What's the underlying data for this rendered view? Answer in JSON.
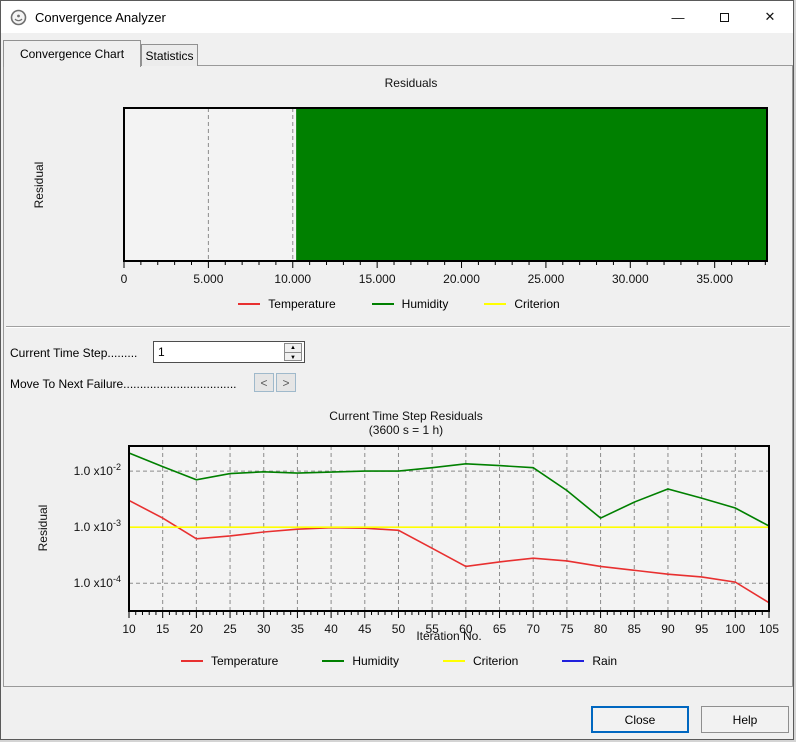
{
  "window": {
    "title": "Convergence Analyzer"
  },
  "icons": {
    "minimize_glyph": "—",
    "close_glyph": "✕",
    "spin_up": "▲",
    "spin_down": "▼"
  },
  "tabs": [
    {
      "label": "Convergence Chart",
      "active": true
    },
    {
      "label": "Statistics",
      "active": false
    }
  ],
  "controls": {
    "time_step_label": "Current Time Step.........",
    "time_step_value": "1",
    "next_failure_label": "Move To Next Failure..................................",
    "prev_glyph": "<",
    "next_glyph": ">"
  },
  "buttons": {
    "close": "Close",
    "help": "Help"
  },
  "colors": {
    "temperature": "#e83030",
    "humidity": "#008000",
    "criterion": "#ffff00",
    "rain": "#2020dd",
    "plot_bg": "#f3f3f3",
    "grid": "#8c8c8c",
    "accent_focus": "#0067c0"
  },
  "chart_data": [
    {
      "type": "area",
      "title": "Residuals",
      "ylabel": "Residual",
      "xlabel": "",
      "xlim": [
        0,
        38100
      ],
      "x_tick_major_step": 5000,
      "x_tick_minor_step": 1000,
      "x_tick_labels": [
        "0",
        "5.000",
        "10.000",
        "15.000",
        "20.000",
        "25.000",
        "30.000",
        "35.000"
      ],
      "gridlines_x": [
        5000,
        10000
      ],
      "filled_region": {
        "series": "Humidity",
        "from": 10200,
        "to": 38100,
        "color": "#008000"
      },
      "grid": true,
      "legend_position": "bottom",
      "legend": [
        {
          "label": "Temperature",
          "color": "#e83030"
        },
        {
          "label": "Humidity",
          "color": "#008000"
        },
        {
          "label": "Criterion",
          "color": "#ffff00"
        }
      ]
    },
    {
      "type": "line",
      "title": "Current Time Step Residuals",
      "subtitle": "(3600 s = 1 h)",
      "xlabel": "Iteration No.",
      "ylabel": "Residual",
      "yscale": "log",
      "ylim": [
        3.2e-05,
        0.028
      ],
      "x": [
        10,
        15,
        20,
        25,
        30,
        35,
        40,
        45,
        50,
        55,
        60,
        65,
        70,
        75,
        80,
        85,
        90,
        95,
        100,
        105
      ],
      "x_tick_minor_step": 1,
      "y_ticks": [
        {
          "value": 0.01,
          "mantissa": "1.0 x10",
          "exponent": "-2"
        },
        {
          "value": 0.001,
          "mantissa": "1.0 x10",
          "exponent": "-3"
        },
        {
          "value": 0.0001,
          "mantissa": "1.0 x10",
          "exponent": "-4"
        }
      ],
      "series": [
        {
          "name": "Temperature",
          "color": "#e83030",
          "values": [
            0.003,
            0.00145,
            0.00062,
            0.0007,
            0.00082,
            0.00092,
            0.00098,
            0.00096,
            0.00088,
            0.00042,
            0.0002,
            0.00024,
            0.00028,
            0.00025,
            0.0002,
            0.00017,
            0.000145,
            0.00013,
            0.000105,
            4.5e-05
          ]
        },
        {
          "name": "Humidity",
          "color": "#008000",
          "values": [
            0.021,
            0.012,
            0.007,
            0.009,
            0.0097,
            0.0092,
            0.0096,
            0.01,
            0.01,
            0.0115,
            0.0135,
            0.0125,
            0.0115,
            0.0045,
            0.00145,
            0.0028,
            0.0048,
            0.0033,
            0.0022,
            0.00105
          ]
        },
        {
          "name": "Criterion",
          "color": "#ffff00",
          "values": [
            0.001,
            0.001,
            0.001,
            0.001,
            0.001,
            0.001,
            0.001,
            0.001,
            0.001,
            0.001,
            0.001,
            0.001,
            0.001,
            0.001,
            0.001,
            0.001,
            0.001,
            0.001,
            0.001,
            0.001
          ]
        },
        {
          "name": "Rain",
          "color": "#2020dd",
          "values": []
        }
      ],
      "grid": true,
      "legend_position": "bottom",
      "legend": [
        {
          "label": "Temperature",
          "color": "#e83030"
        },
        {
          "label": "Humidity",
          "color": "#008000"
        },
        {
          "label": "Criterion",
          "color": "#ffff00"
        },
        {
          "label": "Rain",
          "color": "#2020dd"
        }
      ]
    }
  ]
}
